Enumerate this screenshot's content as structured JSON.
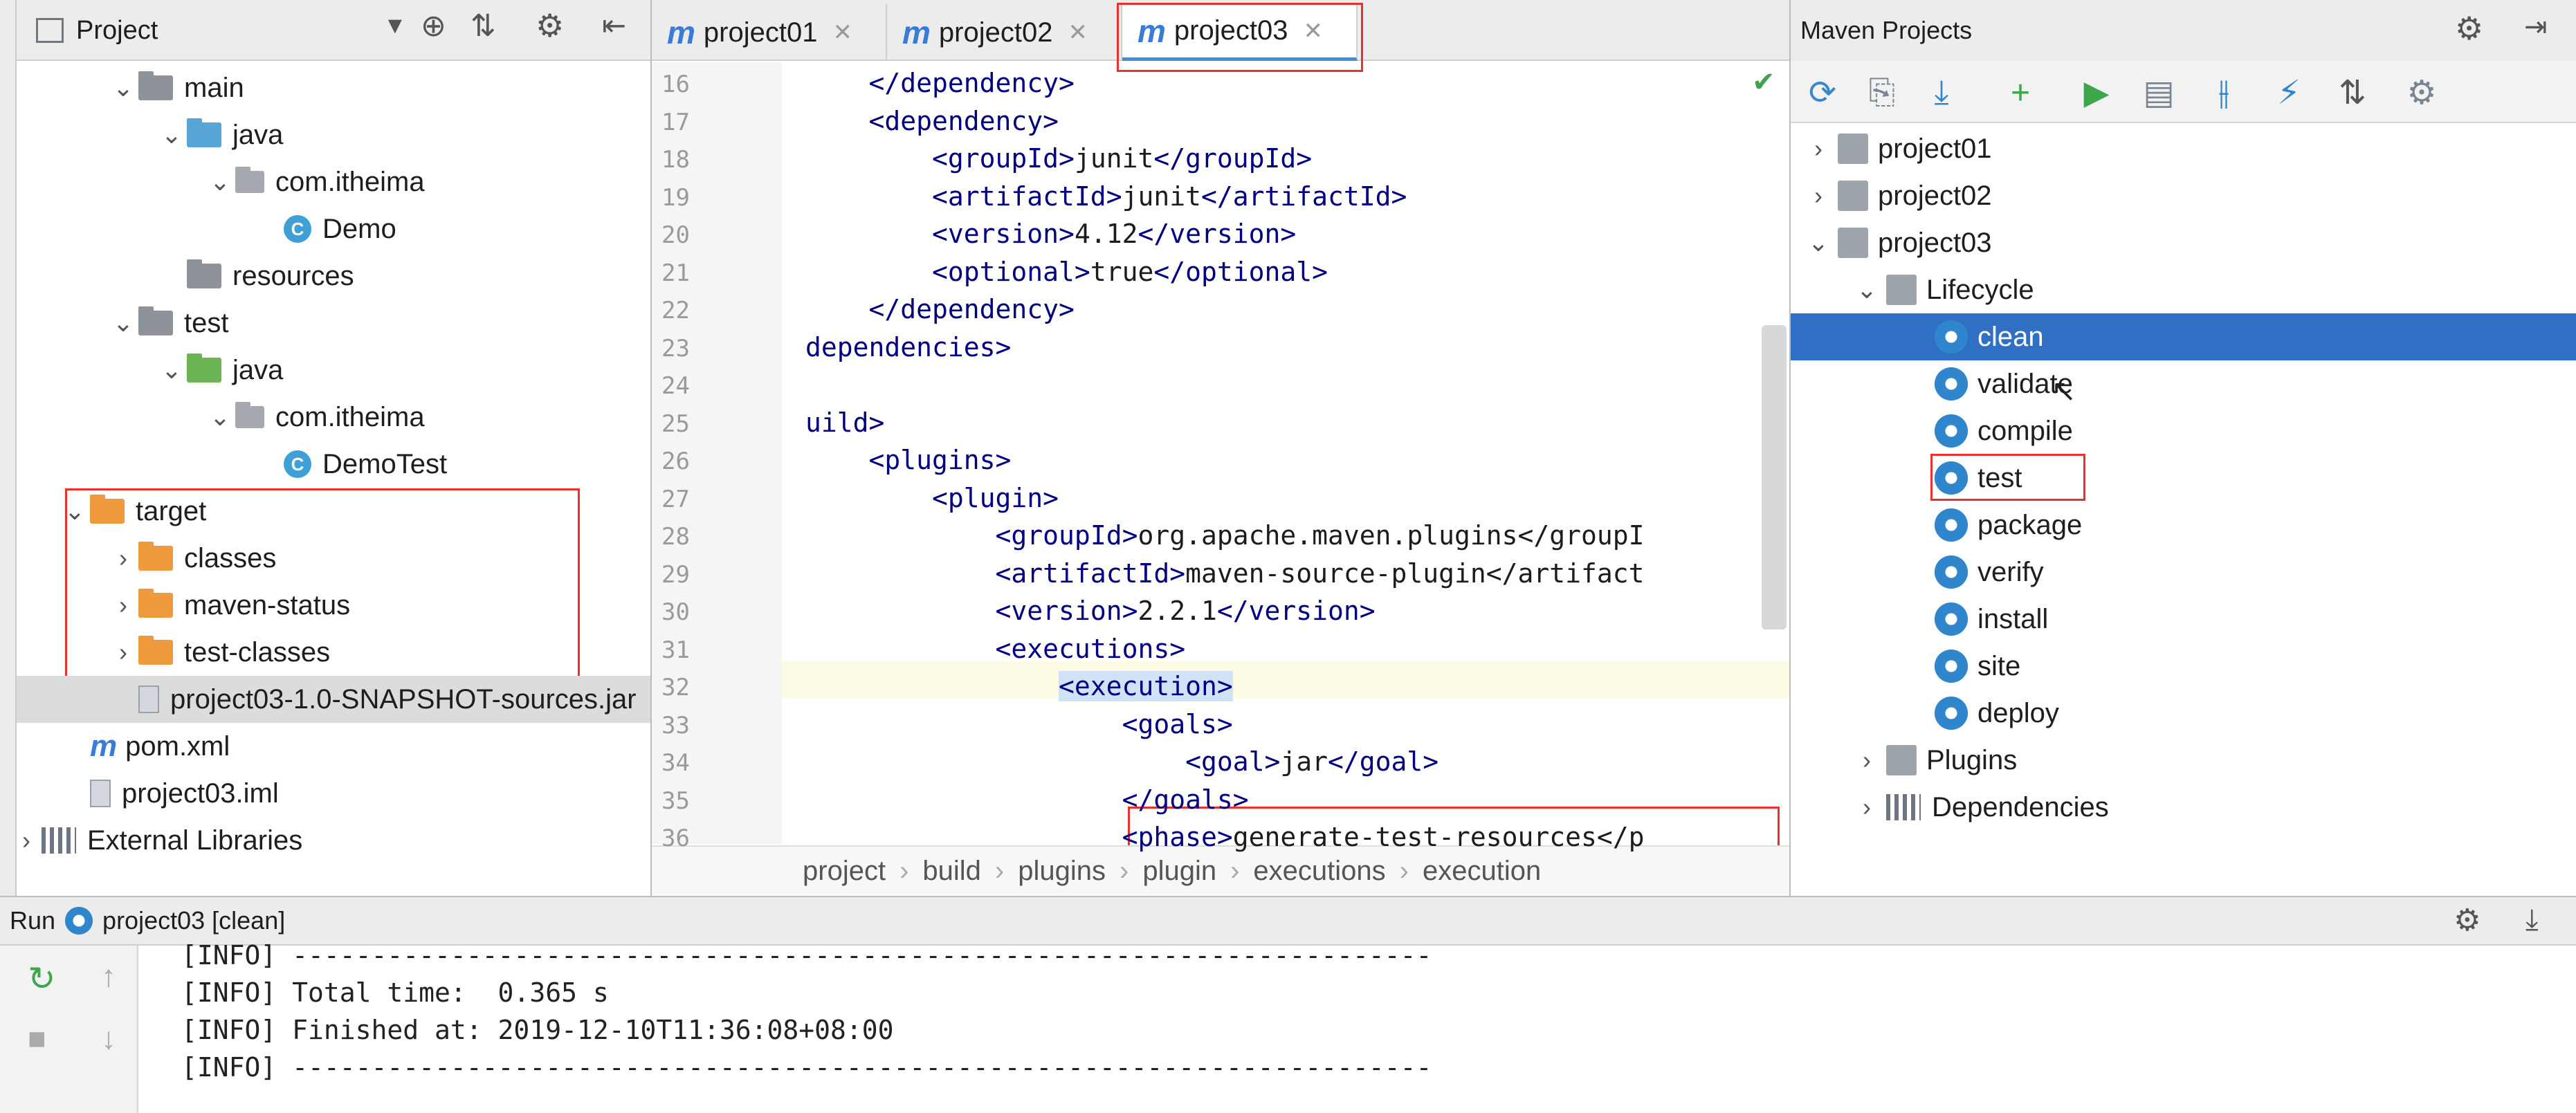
{
  "project_panel": {
    "title": "Project",
    "tree": [
      {
        "label": "main",
        "indent": 1,
        "expanded": true,
        "icon": "folder-gray"
      },
      {
        "label": "java",
        "indent": 2,
        "expanded": true,
        "icon": "folder-blue"
      },
      {
        "label": "com.itheima",
        "indent": 3,
        "expanded": true,
        "icon": "package"
      },
      {
        "label": "Demo",
        "indent": 4,
        "icon": "class"
      },
      {
        "label": "resources",
        "indent": 2,
        "icon": "folder-resources"
      },
      {
        "label": "test",
        "indent": 1,
        "expanded": true,
        "icon": "folder-gray"
      },
      {
        "label": "java",
        "indent": 2,
        "expanded": true,
        "icon": "folder-green"
      },
      {
        "label": "com.itheima",
        "indent": 3,
        "expanded": true,
        "icon": "package"
      },
      {
        "label": "DemoTest",
        "indent": 4,
        "icon": "class"
      },
      {
        "label": "target",
        "indent": 0,
        "expanded": true,
        "icon": "folder-orange"
      },
      {
        "label": "classes",
        "indent": 1,
        "expanded": false,
        "icon": "folder-orange"
      },
      {
        "label": "maven-status",
        "indent": 1,
        "expanded": false,
        "icon": "folder-orange"
      },
      {
        "label": "test-classes",
        "indent": 1,
        "expanded": false,
        "icon": "folder-orange"
      },
      {
        "label": "project03-1.0-SNAPSHOT-sources.jar",
        "indent": 1,
        "icon": "jar"
      },
      {
        "label": "pom.xml",
        "indent": 0,
        "icon": "maven"
      },
      {
        "label": "project03.iml",
        "indent": 0,
        "icon": "file"
      },
      {
        "label": "External Libraries",
        "indent": -1,
        "expanded": false,
        "icon": "libraries"
      }
    ]
  },
  "editor": {
    "tabs": [
      {
        "label": "project01",
        "active": false
      },
      {
        "label": "project02",
        "active": false
      },
      {
        "label": "project03",
        "active": true
      }
    ],
    "lines": [
      {
        "n": "16",
        "text": "    </dependency>"
      },
      {
        "n": "17",
        "text": "    <dependency>"
      },
      {
        "n": "18",
        "text": "        <groupId>junit</groupId>"
      },
      {
        "n": "19",
        "text": "        <artifactId>junit</artifactId>"
      },
      {
        "n": "20",
        "text": "        <version>4.12</version>"
      },
      {
        "n": "21",
        "text": "        <optional>true</optional>"
      },
      {
        "n": "22",
        "text": "    </dependency>"
      },
      {
        "n": "23",
        "text": "dependencies>"
      },
      {
        "n": "24",
        "text": ""
      },
      {
        "n": "25",
        "text": "uild>"
      },
      {
        "n": "26",
        "text": "    <plugins>"
      },
      {
        "n": "27",
        "text": "        <plugin>"
      },
      {
        "n": "28",
        "text": "            <groupId>org.apache.maven.plugins</groupI"
      },
      {
        "n": "29",
        "text": "            <artifactId>maven-source-plugin</artifact"
      },
      {
        "n": "30",
        "text": "            <version>2.2.1</version>"
      },
      {
        "n": "31",
        "text": "            <executions>"
      },
      {
        "n": "32",
        "text": "                <execution>"
      },
      {
        "n": "33",
        "text": "                    <goals>"
      },
      {
        "n": "34",
        "text": "                        <goal>jar</goal>"
      },
      {
        "n": "35",
        "text": "                    </goals>"
      },
      {
        "n": "36",
        "text": "                    <phase>generate-test-resources</p"
      }
    ],
    "breadcrumb": [
      "project",
      "build",
      "plugins",
      "plugin",
      "executions",
      "execution"
    ]
  },
  "maven": {
    "title": "Maven Projects",
    "projects": [
      "project01",
      "project02",
      "project03"
    ],
    "lifecycle_label": "Lifecycle",
    "phases": [
      "clean",
      "validate",
      "compile",
      "test",
      "package",
      "verify",
      "install",
      "site",
      "deploy"
    ],
    "selected_phase": "clean",
    "plugins_label": "Plugins",
    "dependencies_label": "Dependencies"
  },
  "run": {
    "label": "Run",
    "config": "project03 [clean]",
    "log": [
      "[INFO] ------------------------------------------------------------------------",
      "[INFO] Total time:  0.365 s",
      "[INFO] Finished at: 2019-12-10T11:36:08+08:00",
      "[INFO] ------------------------------------------------------------------------"
    ]
  },
  "colors": {
    "accent": "#2f6fc4",
    "annotation_red": "#e8302c",
    "xml_tag": "#000080"
  }
}
